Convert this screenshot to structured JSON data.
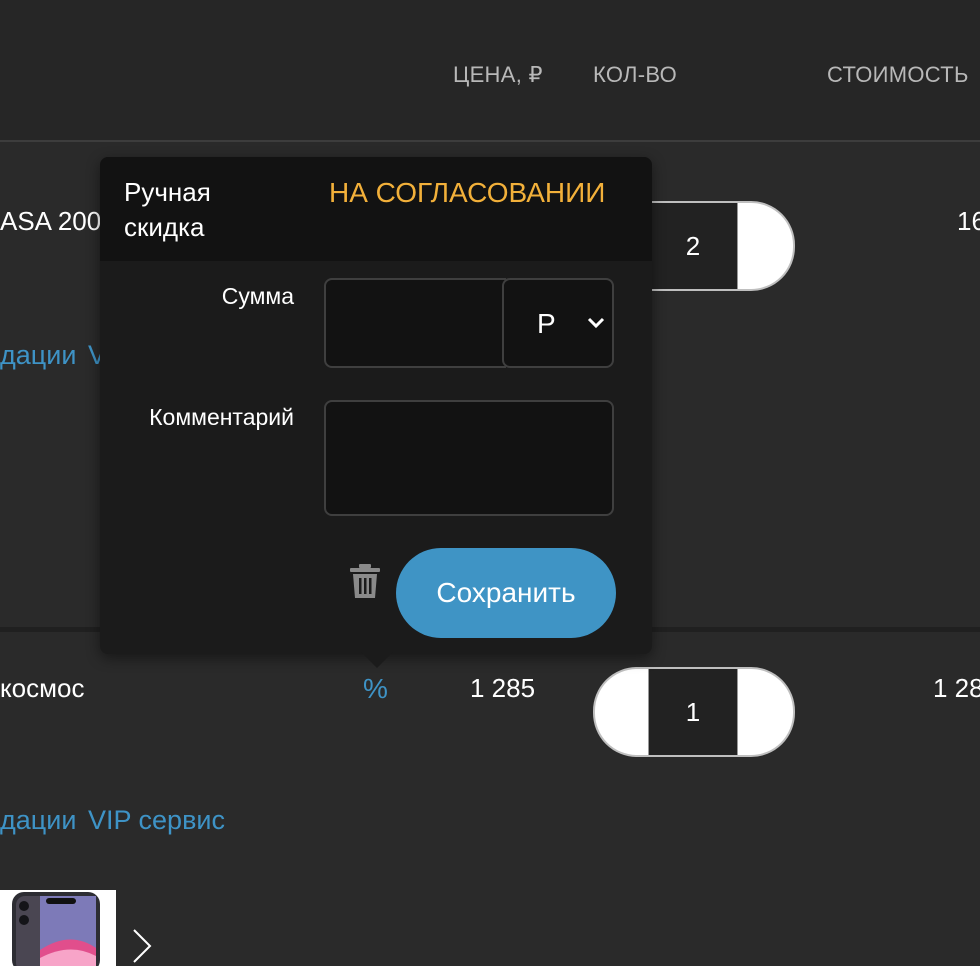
{
  "table_header": {
    "price": "ЦЕНА, ₽",
    "quantity": "КОЛ-ВО",
    "cost": "СТОИМОСТЬ"
  },
  "rows": [
    {
      "name": "ASA 200",
      "quantity": "2",
      "cost": "16",
      "links": [
        "дации",
        "V"
      ]
    },
    {
      "name": "космос",
      "discount_icon": "%",
      "price": "1 285",
      "quantity": "1",
      "cost": "1 28",
      "links": [
        "дации",
        "VIP сервис"
      ]
    }
  ],
  "discount_popover": {
    "title": "Ручная скидка",
    "status": "НА СОГЛАСОВАНИИ",
    "sum_label": "Сумма",
    "sum_value": "",
    "currency_selected": "Р",
    "comment_label": "Комментарий",
    "comment_value": "",
    "save_label": "Сохранить",
    "delete_icon": "trash-icon"
  },
  "colors": {
    "accent": "#3f94c5",
    "status": "#f2b03a",
    "background": "#2a2a2a"
  }
}
